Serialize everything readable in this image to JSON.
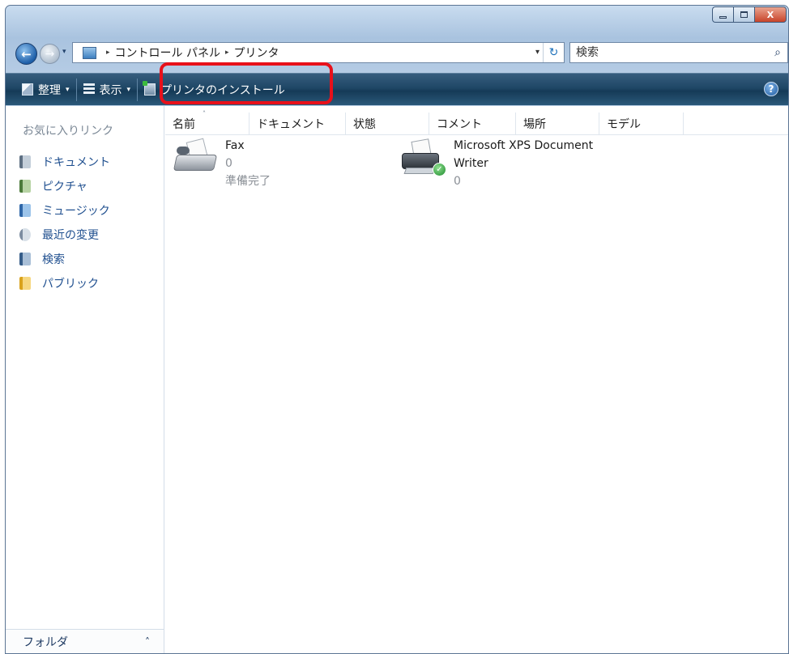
{
  "window": {
    "caption": {
      "minimize_glyph": "",
      "close_glyph": "X"
    }
  },
  "nav": {
    "back_glyph": "←",
    "forward_glyph": "→",
    "recent_glyph": "▾"
  },
  "address": {
    "breadcrumbs": [
      "コントロール パネル",
      "プリンタ"
    ],
    "separator": "▸",
    "dropdown_glyph": "▾",
    "refresh_glyph": "↻"
  },
  "search": {
    "placeholder": "検索",
    "icon_glyph": "⌕"
  },
  "toolbar": {
    "organize_label": "整理",
    "view_label": "表示",
    "install_printer_label": "プリンタのインストール",
    "arrow_glyph": "▾",
    "help_glyph": "?"
  },
  "sidebar": {
    "favorites_header": "お気に入りリンク",
    "items": [
      {
        "label": "ドキュメント",
        "icon": "documents-icon"
      },
      {
        "label": "ピクチャ",
        "icon": "pictures-icon"
      },
      {
        "label": "ミュージック",
        "icon": "music-icon"
      },
      {
        "label": "最近の変更",
        "icon": "recent-changes-icon"
      },
      {
        "label": "検索",
        "icon": "searches-icon"
      },
      {
        "label": "パブリック",
        "icon": "public-folder-icon"
      }
    ],
    "folders_label": "フォルダ",
    "folders_chevron": "˄"
  },
  "columns": {
    "headers": [
      "名前",
      "ドキュメント",
      "状態",
      "コメント",
      "場所",
      "モデル"
    ],
    "sort_glyph": "˄"
  },
  "printers": [
    {
      "name": "Fax",
      "documents": "0",
      "status": "準備完了",
      "icon": "fax-icon"
    },
    {
      "name_line1": "Microsoft XPS Document",
      "name_line2": "Writer",
      "documents": "0",
      "icon": "printer-default-icon",
      "default_glyph": "✓"
    }
  ]
}
